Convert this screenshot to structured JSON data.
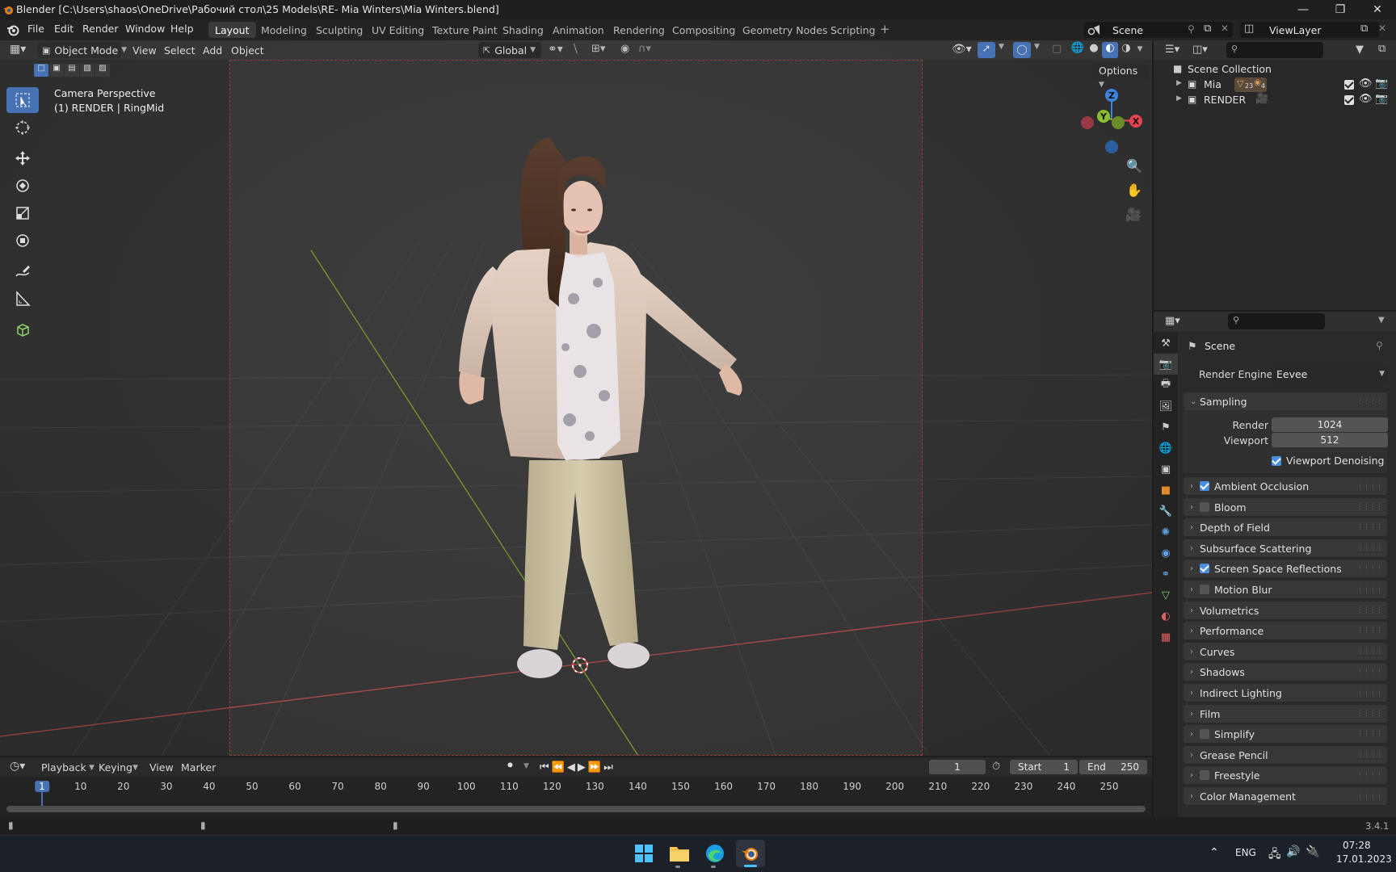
{
  "window": {
    "title": "Blender [C:\\Users\\shaos\\OneDrive\\Рабочий стол\\25 Models\\RE- Mia Winters\\Mia Winters.blend]"
  },
  "menubar": {
    "menus": [
      "File",
      "Edit",
      "Render",
      "Window",
      "Help"
    ],
    "workspaces": [
      "Layout",
      "Modeling",
      "Sculpting",
      "UV Editing",
      "Texture Paint",
      "Shading",
      "Animation",
      "Rendering",
      "Compositing",
      "Geometry Nodes",
      "Scripting"
    ],
    "active_workspace": "Layout",
    "scene_name": "Scene",
    "view_layer": "ViewLayer"
  },
  "viewport_header": {
    "mode": "Object Mode",
    "menus": [
      "View",
      "Select",
      "Add",
      "Object"
    ],
    "transform_orientation": "Global",
    "options_label": "Options"
  },
  "viewport": {
    "camera_label": "Camera Perspective",
    "object_label": "(1) RENDER | RingMid",
    "gizmo_axes": [
      "Z",
      "Y",
      "X"
    ]
  },
  "outliner": {
    "root": "Scene Collection",
    "collections": [
      {
        "name": "Mia",
        "badge1": "23",
        "badge2": "4"
      },
      {
        "name": "RENDER"
      }
    ]
  },
  "properties": {
    "context": "Scene",
    "render_engine_label": "Render Engine",
    "render_engine": "Eevee",
    "sampling": {
      "title": "Sampling",
      "render_label": "Render",
      "render_value": "1024",
      "viewport_label": "Viewport",
      "viewport_value": "512",
      "denoise_label": "Viewport Denoising",
      "denoise_checked": true
    },
    "panels": [
      {
        "label": "Ambient Occlusion",
        "checkbox": true,
        "checked": true
      },
      {
        "label": "Bloom",
        "checkbox": true,
        "checked": false
      },
      {
        "label": "Depth of Field",
        "checkbox": false
      },
      {
        "label": "Subsurface Scattering",
        "checkbox": false
      },
      {
        "label": "Screen Space Reflections",
        "checkbox": true,
        "checked": true
      },
      {
        "label": "Motion Blur",
        "checkbox": true,
        "checked": false
      },
      {
        "label": "Volumetrics",
        "checkbox": false
      },
      {
        "label": "Performance",
        "checkbox": false
      },
      {
        "label": "Curves",
        "checkbox": false
      },
      {
        "label": "Shadows",
        "checkbox": false
      },
      {
        "label": "Indirect Lighting",
        "checkbox": false
      },
      {
        "label": "Film",
        "checkbox": false
      },
      {
        "label": "Simplify",
        "checkbox": true,
        "checked": false
      },
      {
        "label": "Grease Pencil",
        "checkbox": false
      },
      {
        "label": "Freestyle",
        "checkbox": true,
        "checked": false
      },
      {
        "label": "Color Management",
        "checkbox": false
      }
    ]
  },
  "timeline": {
    "menus": [
      "Playback",
      "Keying",
      "View",
      "Marker"
    ],
    "current_frame": "1",
    "start_label": "Start",
    "start": "1",
    "end_label": "End",
    "end": "250",
    "ruler": [
      "1",
      "10",
      "20",
      "30",
      "40",
      "50",
      "60",
      "70",
      "80",
      "90",
      "100",
      "110",
      "120",
      "130",
      "140",
      "150",
      "160",
      "170",
      "180",
      "190",
      "200",
      "210",
      "220",
      "230",
      "240",
      "250"
    ]
  },
  "status": {
    "version": "3.4.1"
  },
  "taskbar": {
    "lang": "ENG",
    "time": "07:28",
    "date": "17.01.2023"
  },
  "colors": {
    "accent": "#4772b3",
    "x_axis": "#e8434f",
    "y_axis": "#8bbd2c",
    "z_axis": "#3b85e0"
  }
}
